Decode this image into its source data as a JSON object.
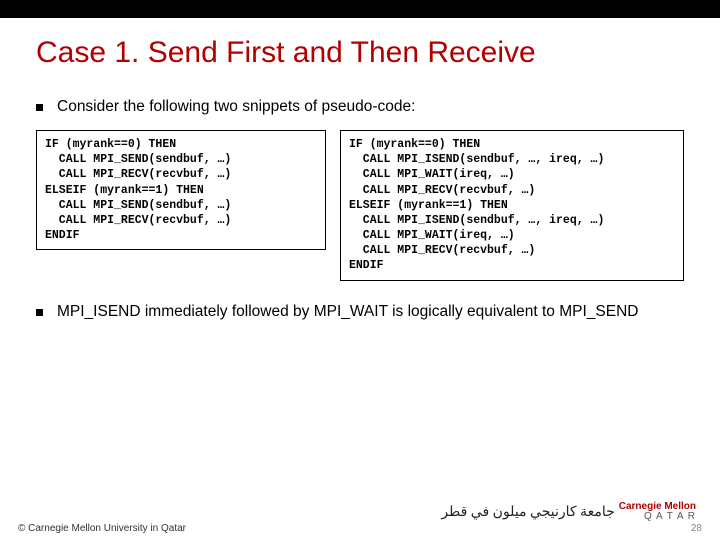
{
  "title": "Case 1. Send First and Then Receive",
  "bullets": {
    "intro": "Consider the following two snippets of pseudo-code:",
    "note": "MPI_ISEND immediately followed by MPI_WAIT is logically equivalent to MPI_SEND"
  },
  "code": {
    "left": "IF (myrank==0) THEN\n  CALL MPI_SEND(sendbuf, …)\n  CALL MPI_RECV(recvbuf, …)\nELSEIF (myrank==1) THEN\n  CALL MPI_SEND(sendbuf, …)\n  CALL MPI_RECV(recvbuf, …)\nENDIF",
    "right": "IF (myrank==0) THEN\n  CALL MPI_ISEND(sendbuf, …, ireq, …)\n  CALL MPI_WAIT(ireq, …)\n  CALL MPI_RECV(recvbuf, …)\nELSEIF (myrank==1) THEN\n  CALL MPI_ISEND(sendbuf, …, ireq, …)\n  CALL MPI_WAIT(ireq, …)\n  CALL MPI_RECV(recvbuf, …)\nENDIF"
  },
  "footer": {
    "copyright": "© Carnegie Mellon University in Qatar",
    "page": "28"
  },
  "logo": {
    "line1": "Carnegie Mellon",
    "line2": "Q A T A R",
    "arabic": "جامعة كارنيجي ميلون في قطر"
  }
}
